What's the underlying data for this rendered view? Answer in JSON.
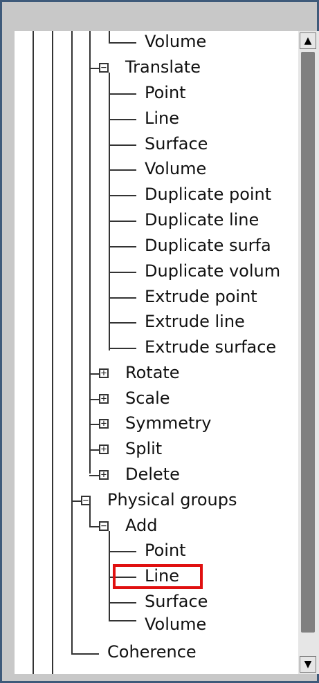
{
  "tree": {
    "items": [
      {
        "label": "Volume",
        "expander": ""
      },
      {
        "label": "Translate",
        "expander": "−"
      },
      {
        "label": "Point",
        "expander": ""
      },
      {
        "label": "Line",
        "expander": ""
      },
      {
        "label": "Surface",
        "expander": ""
      },
      {
        "label": "Volume",
        "expander": ""
      },
      {
        "label": "Duplicate point",
        "expander": ""
      },
      {
        "label": "Duplicate line",
        "expander": ""
      },
      {
        "label": "Duplicate surfa",
        "expander": ""
      },
      {
        "label": "Duplicate volum",
        "expander": ""
      },
      {
        "label": "Extrude point",
        "expander": ""
      },
      {
        "label": "Extrude line",
        "expander": ""
      },
      {
        "label": "Extrude surface",
        "expander": ""
      },
      {
        "label": "Rotate",
        "expander": "+"
      },
      {
        "label": "Scale",
        "expander": "+"
      },
      {
        "label": "Symmetry",
        "expander": "+"
      },
      {
        "label": "Split",
        "expander": "+"
      },
      {
        "label": "Delete",
        "expander": "+"
      },
      {
        "label": "Physical groups",
        "expander": "−"
      },
      {
        "label": "Add",
        "expander": "−"
      },
      {
        "label": "Point",
        "expander": ""
      },
      {
        "label": "Line",
        "expander": ""
      },
      {
        "label": "Surface",
        "expander": ""
      },
      {
        "label": "Volume",
        "expander": ""
      },
      {
        "label": "Coherence",
        "expander": ""
      }
    ]
  },
  "scrollbar": {
    "up": "▲",
    "down": "▼"
  },
  "colors": {
    "highlight": "#e01010",
    "frame": "#3e5a7a"
  }
}
